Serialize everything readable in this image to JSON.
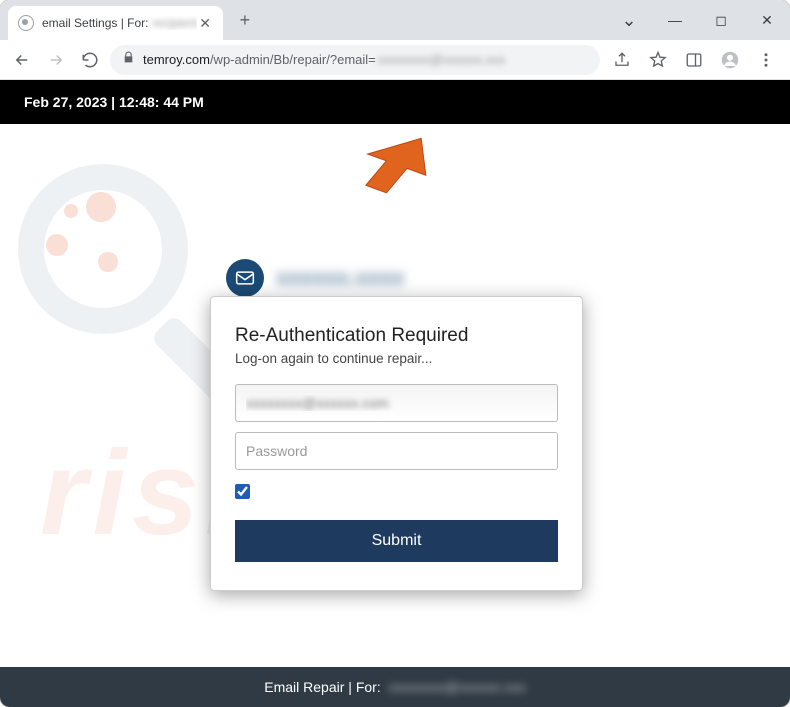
{
  "browser": {
    "tab_title_prefix": "email Settings | For: ",
    "tab_title_blur": "recipient",
    "url_domain": "temroy.com",
    "url_path": "/wp-admin/Bb/repair/?email=",
    "url_blur": "xxxxxxxx@xxxxxx.xxx"
  },
  "datebar": {
    "text": "Feb 27, 2023 | 12:48: 44 PM"
  },
  "header_email": "xxxxxx.xxxx",
  "card": {
    "title": "Re-Authentication Required",
    "subtitle": "Log-on again to continue repair...",
    "email_value": "xxxxxxxx@xxxxxx.com",
    "password_placeholder": "Password",
    "checkbox_checked": true,
    "submit_label": "Submit"
  },
  "footer": {
    "label": "Email Repair | For: ",
    "blur": "xxxxxxxx@xxxxxx.xxx"
  },
  "watermark_text": "risk.com"
}
